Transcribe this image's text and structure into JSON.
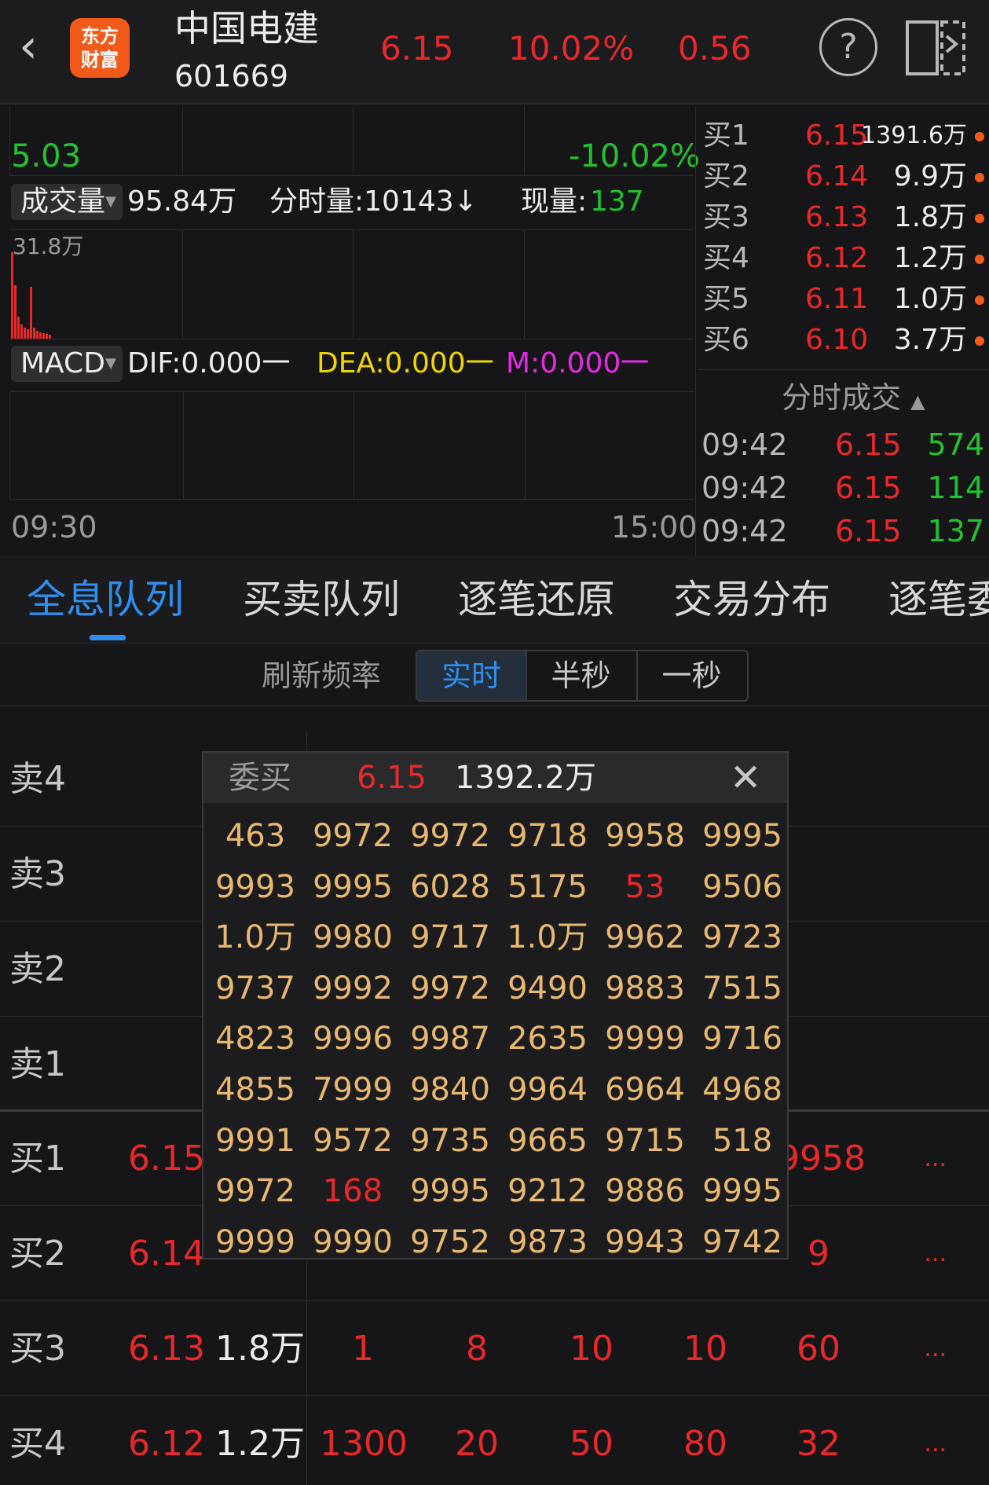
{
  "header": {
    "logo_line1": "东方",
    "logo_line2": "财富",
    "stock_name": "中国电建",
    "stock_code": "601669",
    "price": "6.15",
    "change_pct": "10.02%",
    "change_amt": "0.56"
  },
  "chart": {
    "low_price": "5.03",
    "low_pct": "-10.02%",
    "volume_selector": "成交量",
    "total_volume": "95.84万",
    "minute_volume": "分时量:10143↓",
    "current_volume_label": "现量:",
    "current_volume_value": "137",
    "volume_axis_max": "31.8万",
    "macd_selector": "MACD",
    "dif": "DIF:0.000一",
    "dea": "DEA:0.000一",
    "m": "M:0.000一",
    "time_start": "09:30",
    "time_end": "15:00"
  },
  "bid_quotes": [
    {
      "label": "买1",
      "price": "6.15",
      "volume": "1391.6万"
    },
    {
      "label": "买2",
      "price": "6.14",
      "volume": "9.9万"
    },
    {
      "label": "买3",
      "price": "6.13",
      "volume": "1.8万"
    },
    {
      "label": "买4",
      "price": "6.12",
      "volume": "1.2万"
    },
    {
      "label": "买5",
      "price": "6.11",
      "volume": "1.0万"
    },
    {
      "label": "买6",
      "price": "6.10",
      "volume": "3.7万"
    }
  ],
  "ticks": {
    "header": "分时成交",
    "rows": [
      {
        "time": "09:42",
        "price": "6.15",
        "volume": "574"
      },
      {
        "time": "09:42",
        "price": "6.15",
        "volume": "114"
      },
      {
        "time": "09:42",
        "price": "6.15",
        "volume": "137"
      }
    ]
  },
  "tabs": [
    "全息队列",
    "买卖队列",
    "逐笔还原",
    "交易分布",
    "逐笔委"
  ],
  "refresh": {
    "label": "刷新频率",
    "options": [
      "实时",
      "半秒",
      "一秒"
    ]
  },
  "queue": {
    "sell_rows": [
      "卖4",
      "卖3",
      "卖2",
      "卖1"
    ],
    "buy_rows": [
      {
        "label": "买1",
        "price": "6.15",
        "volume": "",
        "cells": [
          "",
          "",
          "",
          "",
          "9958"
        ],
        "more": "..."
      },
      {
        "label": "买2",
        "price": "6.14",
        "volume": "",
        "cells": [
          "",
          "",
          "",
          "",
          "9"
        ],
        "more": "..."
      },
      {
        "label": "买3",
        "price": "6.13",
        "volume": "1.8万",
        "cells": [
          "1",
          "8",
          "10",
          "10",
          "60"
        ],
        "more": "..."
      },
      {
        "label": "买4",
        "price": "6.12",
        "volume": "1.2万",
        "cells": [
          "1300",
          "20",
          "50",
          "80",
          "32"
        ],
        "more": "..."
      }
    ]
  },
  "popup": {
    "title": "委买",
    "price": "6.15",
    "total": "1392.2万",
    "grid": [
      [
        "463",
        "9972",
        "9972",
        "9718",
        "9958",
        "9995"
      ],
      [
        "9993",
        "9995",
        "6028",
        "5175",
        "53",
        "9506"
      ],
      [
        "1.0万",
        "9980",
        "9717",
        "1.0万",
        "9962",
        "9723"
      ],
      [
        "9737",
        "9992",
        "9972",
        "9490",
        "9883",
        "7515"
      ],
      [
        "4823",
        "9996",
        "9987",
        "2635",
        "9999",
        "9716"
      ],
      [
        "4855",
        "7999",
        "9840",
        "9964",
        "6964",
        "4968"
      ],
      [
        "9991",
        "9572",
        "9735",
        "9665",
        "9715",
        "518"
      ],
      [
        "9972",
        "168",
        "9995",
        "9212",
        "9886",
        "9995"
      ],
      [
        "9999",
        "9990",
        "9752",
        "9873",
        "9943",
        "9742"
      ]
    ],
    "highlight": [
      "53",
      "168"
    ]
  }
}
